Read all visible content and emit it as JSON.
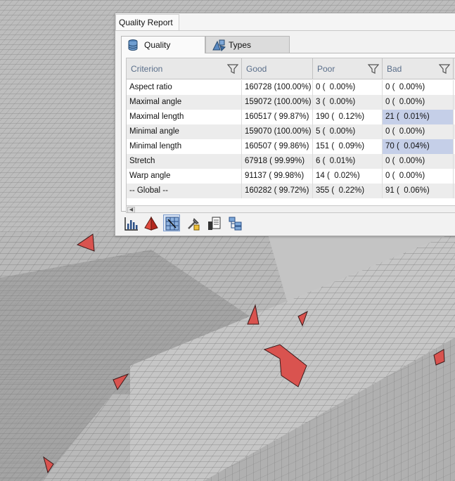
{
  "panel": {
    "title": "Quality Report",
    "tabs": [
      {
        "label": "Quality",
        "icon": "database-icon",
        "active": true
      },
      {
        "label": "Types",
        "icon": "shapes-icon",
        "active": false
      }
    ]
  },
  "table": {
    "columns": [
      "Criterion",
      "Good",
      "Poor",
      "Bad"
    ],
    "rows": [
      {
        "criterion": "Aspect ratio",
        "good": "160728 (100.00%)",
        "poor": "0 (  0.00%)",
        "bad": "0 (  0.00%)",
        "bad_highlight": false
      },
      {
        "criterion": "Maximal angle",
        "good": "159072 (100.00%)",
        "poor": "3 (  0.00%)",
        "bad": "0 (  0.00%)",
        "bad_highlight": false
      },
      {
        "criterion": "Maximal length",
        "good": "160517 ( 99.87%)",
        "poor": "190 (  0.12%)",
        "bad": "21 (  0.01%)",
        "bad_highlight": true
      },
      {
        "criterion": "Minimal angle",
        "good": "159070 (100.00%)",
        "poor": "5 (  0.00%)",
        "bad": "0 (  0.00%)",
        "bad_highlight": false
      },
      {
        "criterion": "Minimal length",
        "good": "160507 ( 99.86%)",
        "poor": "151 (  0.09%)",
        "bad": "70 (  0.04%)",
        "bad_highlight": true
      },
      {
        "criterion": "Stretch",
        "good": "67918 ( 99.99%)",
        "poor": "6 (  0.01%)",
        "bad": "0 (  0.00%)",
        "bad_highlight": false
      },
      {
        "criterion": "Warp angle",
        "good": "91137 ( 99.98%)",
        "poor": "14 (  0.02%)",
        "bad": "0 (  0.00%)",
        "bad_highlight": false
      },
      {
        "criterion": "-- Global --",
        "good": "160282 ( 99.72%)",
        "poor": "355 (  0.22%)",
        "bad": "91 (  0.06%)",
        "bad_highlight": false
      }
    ]
  },
  "toolbar": {
    "buttons": [
      {
        "icon": "histogram-icon"
      },
      {
        "icon": "red-pyramid-icon"
      },
      {
        "icon": "mesh-select-icon"
      },
      {
        "icon": "tools-icon"
      },
      {
        "icon": "export-report-icon"
      },
      {
        "icon": "tree-view-icon"
      }
    ]
  },
  "colors": {
    "highlight": "#c5cfe8",
    "mesh_background": "#c8c8c8",
    "bad_element_fill": "#d9534f",
    "header_text": "#5a6e8a"
  }
}
